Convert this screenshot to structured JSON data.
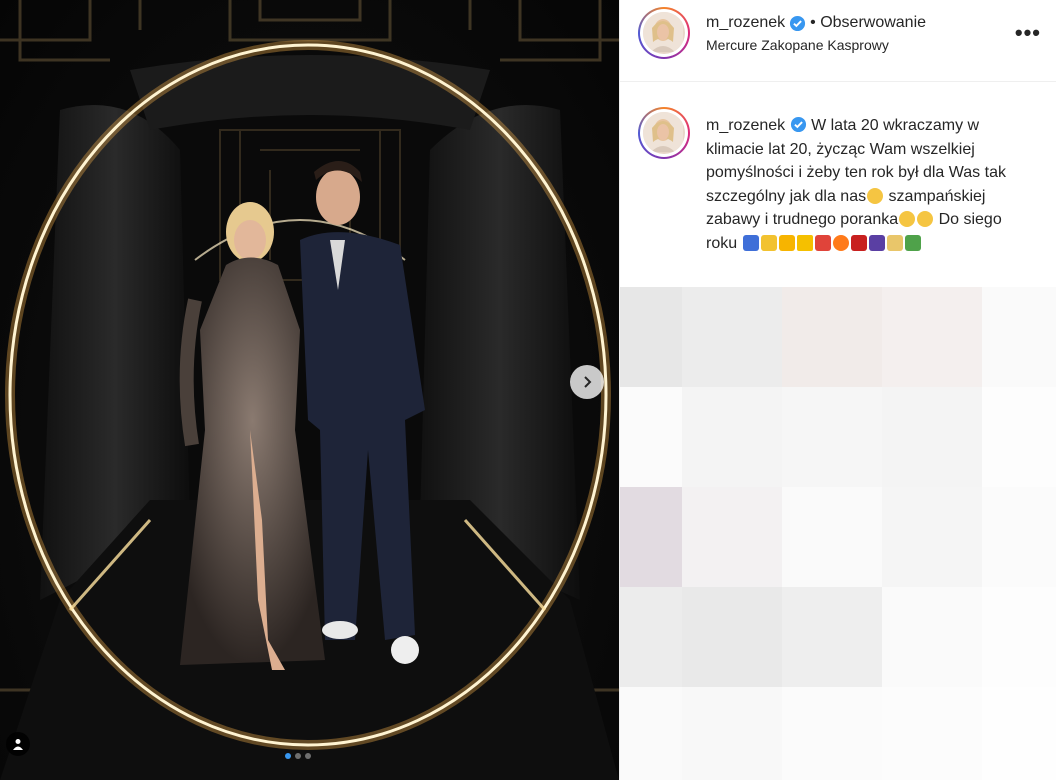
{
  "post": {
    "username": "m_rozenek",
    "follow_label": "• Obserwowanie",
    "location": "Mercure Zakopane Kasprowy",
    "more_label": "•••",
    "caption": "W lata 20 wkraczamy w klimacie lat 20, życząc Wam wszelkiej pomyślności i żeby ten rok był dla Was tak szczególny jak dla nas",
    "caption_2": " szampańskiej zabawy i trudnego poranka",
    "caption_3": " Do siego roku ",
    "carousel": {
      "slides": 3,
      "active": 1
    }
  },
  "colors": {
    "verified": "#3897f0",
    "ring_glow": "#ffd27a",
    "accent": "#3897f0"
  },
  "icons": [
    "verified-badge-icon",
    "chevron-right-icon",
    "person-tag-icon",
    "more-options-icon"
  ]
}
